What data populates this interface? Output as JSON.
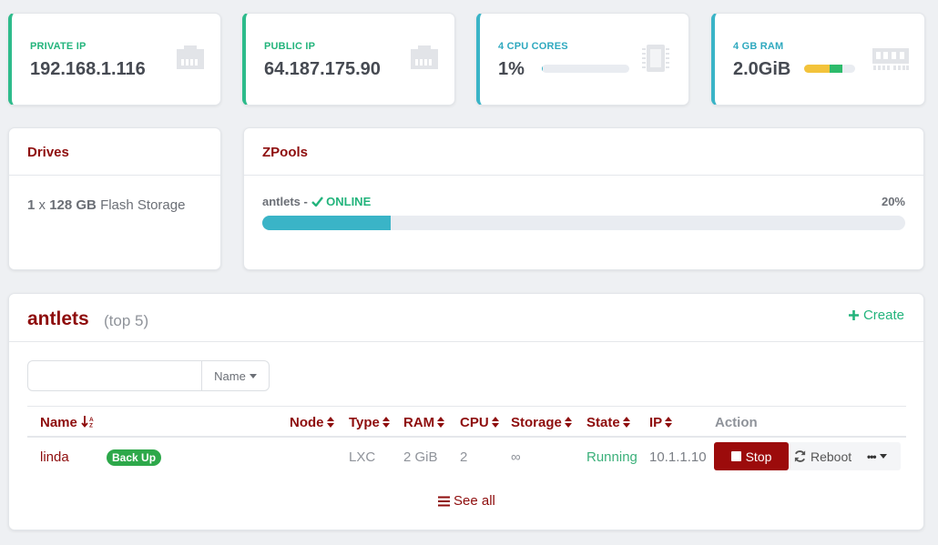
{
  "stats": {
    "private_ip": {
      "label": "PRIVATE IP",
      "value": "192.168.1.116"
    },
    "public_ip": {
      "label": "PUBLIC IP",
      "value": "64.187.175.90"
    },
    "cpu": {
      "label": "4 CPU CORES",
      "value": "1%",
      "usage": 0.01
    },
    "ram": {
      "label": "4 GB RAM",
      "value": "2.0GiB",
      "segments": [
        0.5,
        0.25
      ]
    }
  },
  "drives": {
    "title": "Drives",
    "count": "1",
    "times": "x",
    "size": "128 GB",
    "kind": "Flash Storage"
  },
  "zpools": {
    "title": "ZPools",
    "pool_name": "antlets",
    "separator": "-",
    "status": "ONLINE",
    "percent": "20%",
    "usage": 0.2
  },
  "antlets": {
    "title": "antlets",
    "subtitle": "(top 5)",
    "create_label": "Create",
    "search": {
      "value": "",
      "filter_label": "Name"
    },
    "columns": [
      "Name",
      "Node",
      "Type",
      "RAM",
      "CPU",
      "Storage",
      "State",
      "IP",
      "Action"
    ],
    "rows": [
      {
        "name": "linda",
        "badge": "Back Up",
        "node": "",
        "type": "LXC",
        "ram": "2 GiB",
        "cpu": "2",
        "storage": "∞",
        "state": "Running",
        "ip": "10.1.1.10",
        "stop_label": "Stop",
        "reboot_label": "Reboot",
        "more_label": "•••"
      }
    ],
    "see_all_label": "See all"
  },
  "colors": {
    "brand_red": "#8e0d0d",
    "green": "#23b47c",
    "teal": "#3ab4c7",
    "yellow": "#f3c33b"
  }
}
